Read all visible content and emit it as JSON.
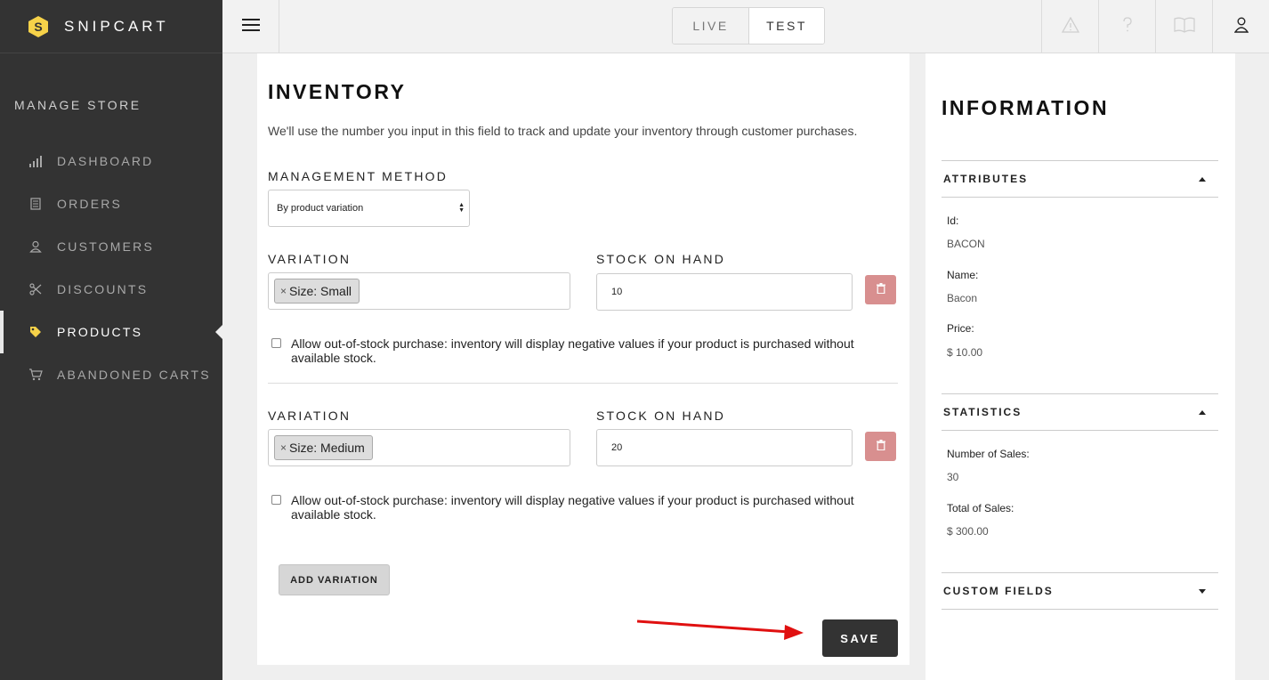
{
  "app": {
    "brand": "SNIPCART",
    "brand_color": "#f6d249"
  },
  "sidebar": {
    "section_label": "MANAGE STORE",
    "items": [
      {
        "label": "DASHBOARD",
        "icon": "bar-chart-icon"
      },
      {
        "label": "ORDERS",
        "icon": "receipt-icon"
      },
      {
        "label": "CUSTOMERS",
        "icon": "person-icon"
      },
      {
        "label": "DISCOUNTS",
        "icon": "scissors-icon"
      },
      {
        "label": "PRODUCTS",
        "icon": "tag-icon",
        "active": true
      },
      {
        "label": "ABANDONED CARTS",
        "icon": "cart-icon"
      }
    ]
  },
  "topbar": {
    "modes": [
      "LIVE",
      "TEST"
    ],
    "active_mode": "TEST",
    "icons": [
      "warning-icon",
      "help-icon",
      "docs-book-icon",
      "account-icon"
    ]
  },
  "inventory": {
    "title": "INVENTORY",
    "description": "We'll use the number you input in this field to track and update your inventory through customer purchases.",
    "method_label": "MANAGEMENT METHOD",
    "method_value": "By product variation",
    "variations": [
      {
        "variation_label": "VARIATION",
        "tag": "Size: Small",
        "stock_label": "STOCK ON HAND",
        "stock": "10",
        "allow_text": "Allow out-of-stock purchase: inventory will display negative values if your product is purchased without available stock."
      },
      {
        "variation_label": "VARIATION",
        "tag": "Size: Medium",
        "stock_label": "STOCK ON HAND",
        "stock": "20",
        "allow_text": "Allow out-of-stock purchase: inventory will display negative values if your product is purchased without available stock."
      }
    ],
    "add_variation": "ADD VARIATION",
    "save": "SAVE",
    "delete_color": "#d88f8f",
    "annotation_arrow_color": "#e01010"
  },
  "information": {
    "title": "INFORMATION",
    "attributes": {
      "heading": "ATTRIBUTES",
      "id_label": "Id:",
      "id": "BACON",
      "name_label": "Name:",
      "name": "Bacon",
      "price_label": "Price:",
      "price": "$ 10.00"
    },
    "statistics": {
      "heading": "STATISTICS",
      "sales_label": "Number of Sales:",
      "sales": "30",
      "total_label": "Total of Sales:",
      "total": "$ 300.00"
    },
    "custom_fields": {
      "heading": "CUSTOM FIELDS"
    }
  }
}
